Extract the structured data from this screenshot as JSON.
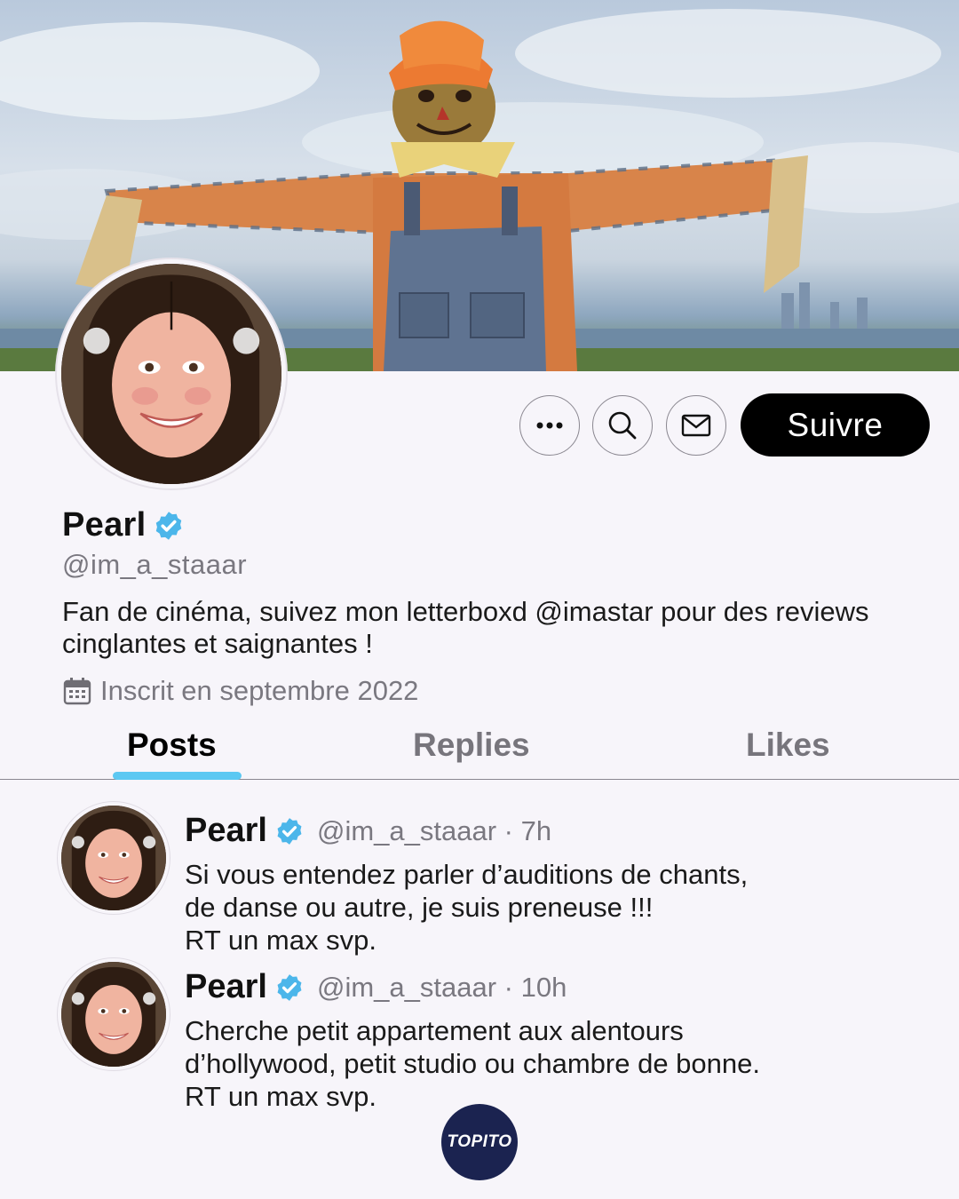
{
  "banner": {
    "icon": "scarecrow-banner-image"
  },
  "profile": {
    "display_name": "Pearl",
    "handle": "@im_a_staaar",
    "bio": "Fan de cinéma, suivez mon letterboxd @imastar pour des reviews cinglantes et saignantes !",
    "joined": "Inscrit en septembre 2022",
    "verified_color": "#4cb6ea"
  },
  "actions": {
    "more_icon": "more-icon",
    "search_icon": "search-icon",
    "mail_icon": "mail-icon",
    "follow_label": "Suivre"
  },
  "tabs": [
    {
      "label": "Posts",
      "active": true
    },
    {
      "label": "Replies",
      "active": false
    },
    {
      "label": "Likes",
      "active": false
    }
  ],
  "posts": [
    {
      "name": "Pearl",
      "handle": "@im_a_staaar",
      "time": "7h",
      "lines": [
        "Si vous entendez parler d’auditions de chants,",
        "de danse ou autre, je suis preneuse !!!",
        "RT un max svp."
      ]
    },
    {
      "name": "Pearl",
      "handle": "@im_a_staaar",
      "time": "10h",
      "lines": [
        "Cherche petit appartement aux alentours",
        "d’hollywood, petit studio ou chambre de bonne.",
        "RT un max svp."
      ]
    }
  ],
  "brand": {
    "label": "TOPITO",
    "color": "#1b2350"
  },
  "colors": {
    "accent": "#5cc8f2",
    "background": "#f7f5fa",
    "muted": "#7a7880"
  }
}
